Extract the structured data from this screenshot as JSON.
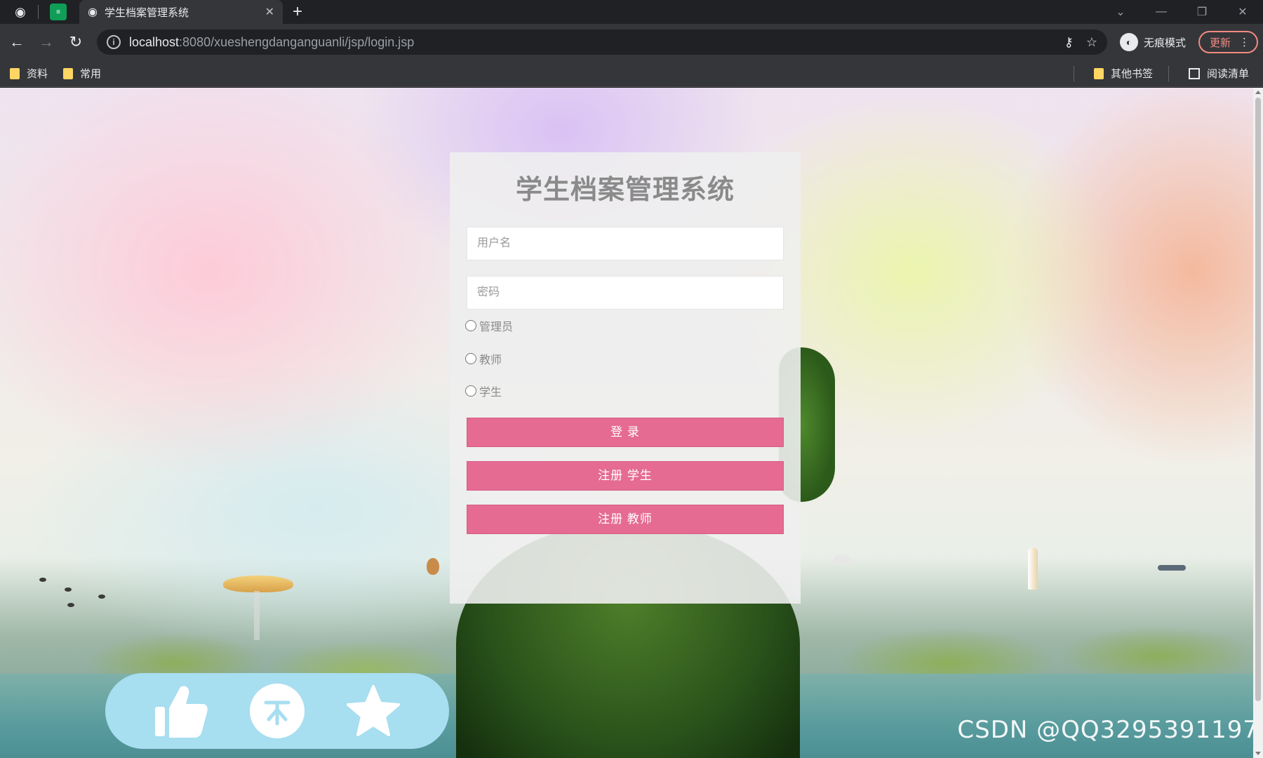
{
  "browser": {
    "tab_title": "学生档案管理系统",
    "url_host": "localhost",
    "url_path": ":8080/xueshengdanganguanli/jsp/login.jsp",
    "incognito_label": "无痕模式",
    "update_label": "更新",
    "bookmarks": [
      "资料",
      "常用"
    ],
    "other_bookmarks": "其他书签",
    "reading_list": "阅读清单"
  },
  "login": {
    "title": "学生档案管理系统",
    "username_placeholder": "用户名",
    "password_placeholder": "密码",
    "roles": [
      "管理员",
      "教师",
      "学生"
    ],
    "login_button": "登 录",
    "register_student_button": "注册 学生",
    "register_teacher_button": "注册 教师"
  },
  "watermark": "CSDN @QQ3295391197",
  "colors": {
    "button_bg": "#e56b93",
    "panel_bg": "#eeeeee",
    "action_bar_bg": "#a7def0",
    "title_color": "#8a8a8a"
  },
  "icons": [
    "thumbs-up-icon",
    "coin-icon",
    "star-icon"
  ]
}
